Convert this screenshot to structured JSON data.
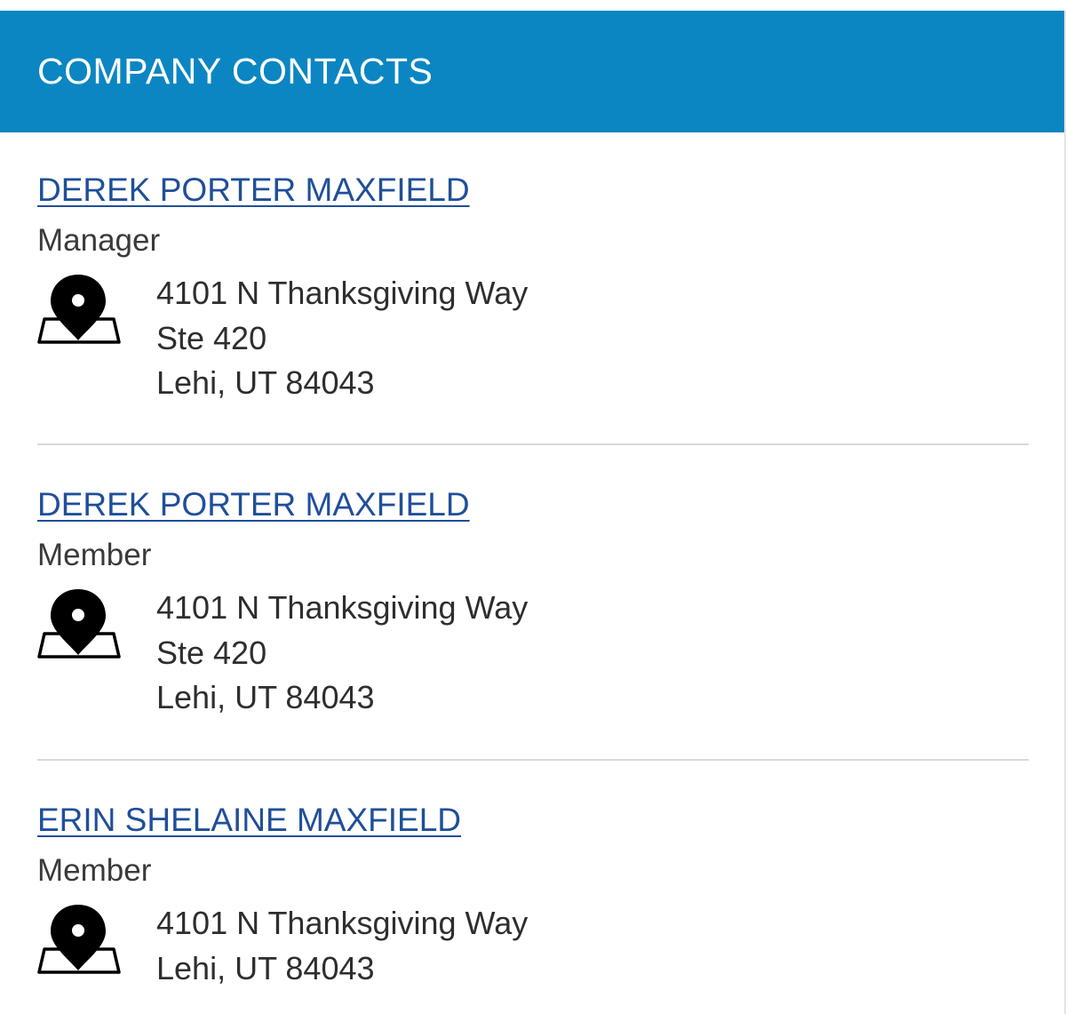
{
  "header": {
    "title": "COMPANY CONTACTS"
  },
  "contacts": [
    {
      "name": "DEREK PORTER MAXFIELD",
      "role": "Manager",
      "address": [
        "4101 N Thanksgiving Way",
        "Ste 420",
        "Lehi, UT 84043"
      ]
    },
    {
      "name": "DEREK PORTER MAXFIELD",
      "role": "Member",
      "address": [
        "4101 N Thanksgiving Way",
        "Ste 420",
        "Lehi, UT 84043"
      ]
    },
    {
      "name": "ERIN SHELAINE MAXFIELD",
      "role": "Member",
      "address": [
        "4101 N Thanksgiving Way",
        "Lehi, UT 84043"
      ]
    }
  ],
  "icons": {
    "address": "map-pin-icon"
  },
  "colors": {
    "header_bg": "#0b86c2",
    "link": "#1f4f99",
    "divider": "#d8d8d8"
  }
}
